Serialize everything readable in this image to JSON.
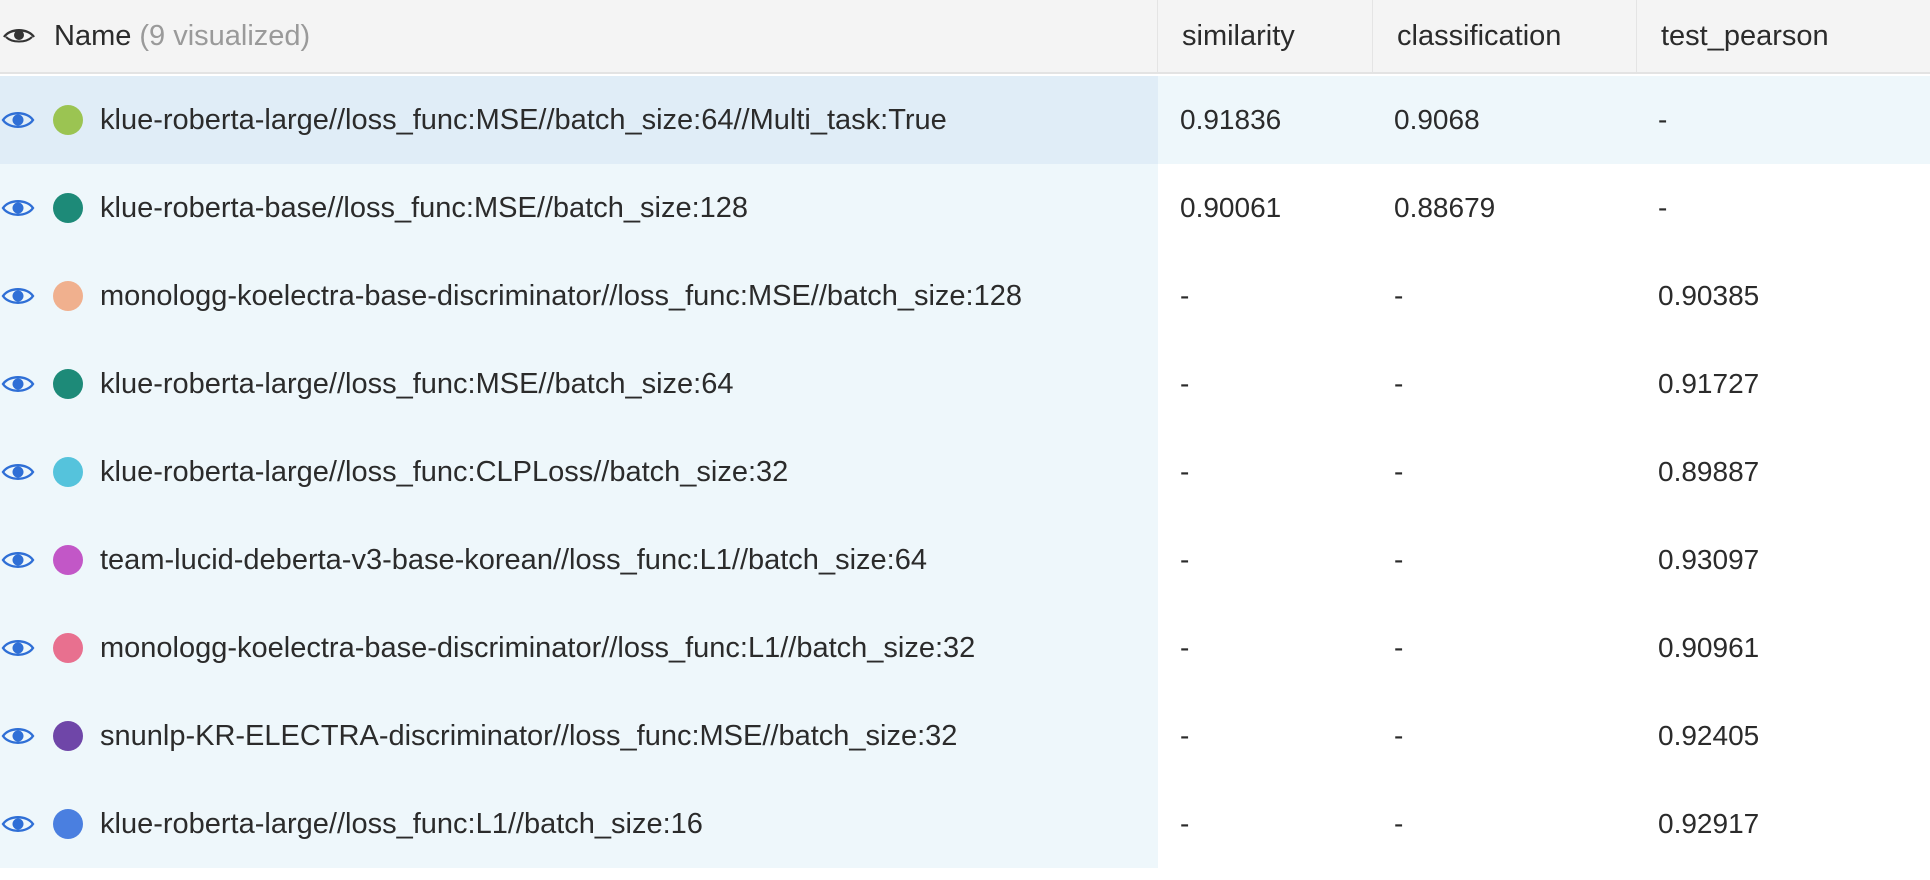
{
  "header": {
    "name_label": "Name",
    "visualized_label": "(9 visualized)",
    "columns": [
      "similarity",
      "classification",
      "test_pearson"
    ]
  },
  "rows": [
    {
      "name": "klue-roberta-large//loss_func:MSE//batch_size:64//Multi_task:True",
      "color": "#9bc452",
      "similarity": "0.91836",
      "classification": "0.9068",
      "test_pearson": "-"
    },
    {
      "name": "klue-roberta-base//loss_func:MSE//batch_size:128",
      "color": "#1d8a78",
      "similarity": "0.90061",
      "classification": "0.88679",
      "test_pearson": "-"
    },
    {
      "name": "monologg-koelectra-base-discriminator//loss_func:MSE//batch_size:128",
      "color": "#f0b08e",
      "similarity": "-",
      "classification": "-",
      "test_pearson": "0.90385"
    },
    {
      "name": "klue-roberta-large//loss_func:MSE//batch_size:64",
      "color": "#1d8a78",
      "similarity": "-",
      "classification": "-",
      "test_pearson": "0.91727"
    },
    {
      "name": "klue-roberta-large//loss_func:CLPLoss//batch_size:32",
      "color": "#55c3dc",
      "similarity": "-",
      "classification": "-",
      "test_pearson": "0.89887"
    },
    {
      "name": "team-lucid-deberta-v3-base-korean//loss_func:L1//batch_size:64",
      "color": "#c257c7",
      "similarity": "-",
      "classification": "-",
      "test_pearson": "0.93097"
    },
    {
      "name": "monologg-koelectra-base-discriminator//loss_func:L1//batch_size:32",
      "color": "#e8708f",
      "similarity": "-",
      "classification": "-",
      "test_pearson": "0.90961"
    },
    {
      "name": "snunlp-KR-ELECTRA-discriminator//loss_func:MSE//batch_size:32",
      "color": "#6f46a8",
      "similarity": "-",
      "classification": "-",
      "test_pearson": "0.92405"
    },
    {
      "name": "klue-roberta-large//loss_func:L1//batch_size:16",
      "color": "#4a7fe0",
      "similarity": "-",
      "classification": "-",
      "test_pearson": "0.92917"
    }
  ],
  "colors": {
    "eye_icon": "#2f6fd6",
    "header_bg": "#f4f4f4",
    "name_col_bg": "#eef7fb",
    "selected_row_bg": "#e0edf7"
  }
}
